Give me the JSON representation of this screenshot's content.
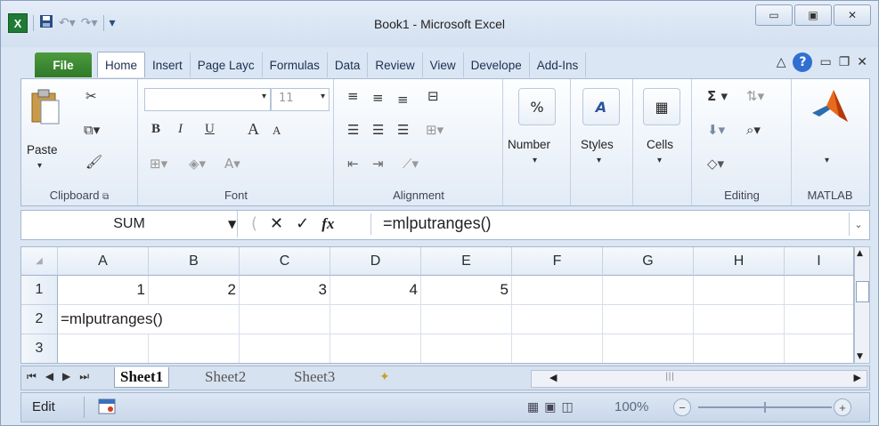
{
  "window": {
    "title": "Book1  -  Microsoft Excel",
    "app_icon": "X",
    "controls": [
      "▭",
      "▣",
      "✕"
    ]
  },
  "qat": {
    "save_icon": "save-icon",
    "undo_icon": "undo-icon",
    "redo_icon": "redo-icon"
  },
  "tabs": [
    {
      "label": "File"
    },
    {
      "label": "Home"
    },
    {
      "label": "Insert"
    },
    {
      "label": "Page Layc"
    },
    {
      "label": "Formulas"
    },
    {
      "label": "Data"
    },
    {
      "label": "Review"
    },
    {
      "label": "View"
    },
    {
      "label": "Develope"
    },
    {
      "label": "Add-Ins"
    }
  ],
  "ribbon": {
    "clipboard": {
      "label": "Clipboard",
      "paste": "Paste"
    },
    "font": {
      "label": "Font",
      "size": "11",
      "bold": "B",
      "italic": "I",
      "underline": "U",
      "grow": "A",
      "shrink": "A"
    },
    "alignment": {
      "label": "Alignment"
    },
    "number": {
      "label": "Number",
      "symbol": "%"
    },
    "styles": {
      "label": "Styles"
    },
    "cells": {
      "label": "Cells"
    },
    "editing": {
      "label": "Editing",
      "sigma": "Σ"
    },
    "matlab": {
      "label": "MATLAB"
    }
  },
  "formula_bar": {
    "name_box": "SUM",
    "cancel": "✕",
    "enter": "✓",
    "fx": "fx",
    "content": "=mlputranges()"
  },
  "grid": {
    "columns": [
      "A",
      "B",
      "C",
      "D",
      "E",
      "F",
      "G",
      "H",
      "I"
    ],
    "rows": [
      "1",
      "2",
      "3"
    ],
    "row1": [
      "1",
      "2",
      "3",
      "4",
      "5"
    ],
    "a2": "=mlputranges()"
  },
  "sheets": [
    "Sheet1",
    "Sheet2",
    "Sheet3"
  ],
  "status": {
    "mode": "Edit",
    "zoom": "100%"
  },
  "colors": {
    "file_tab": "#2f7a28",
    "accent": "#2f6fd0"
  }
}
